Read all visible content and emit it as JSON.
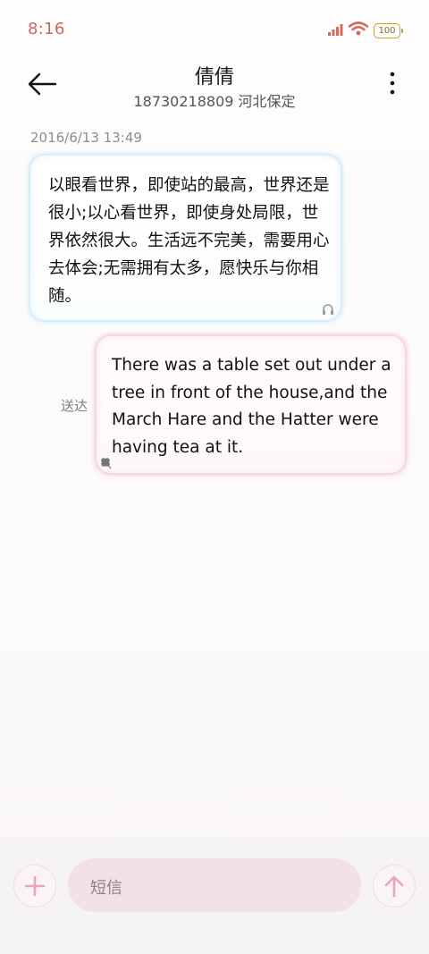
{
  "status_bar": {
    "time": "8:16",
    "battery": "100",
    "icons": [
      "signal-icon",
      "wifi-icon",
      "battery-icon"
    ]
  },
  "header": {
    "contact_name": "倩倩",
    "contact_info": "18730218809 河北保定",
    "icons": [
      "back-arrow-icon",
      "more-vertical-icon"
    ]
  },
  "conversation": {
    "timestamp": "2016/6/13 13:49",
    "messages": [
      {
        "direction": "incoming",
        "text": "以眼看世界，即使站的最高，世界还是很小;以心看世界，即使身处局限，世界依然很大。生活远不完美，需要用心去体会;无需拥有太多，愿快乐与你相随。"
      },
      {
        "direction": "outgoing",
        "status": "送达",
        "text": "There was a table set out under a tree in front of the house,and the March Hare and the Hatter were having tea at it."
      }
    ]
  },
  "composer": {
    "placeholder": "短信",
    "icons": [
      "plus-icon",
      "send-arrow-up-icon"
    ]
  },
  "colors": {
    "status_time": "#c9675f",
    "incoming_border": "#d6eefa",
    "outgoing_border": "#f6d6df",
    "input_bg": "#f2e1e6",
    "accent_pink": "#e9a7b6"
  }
}
